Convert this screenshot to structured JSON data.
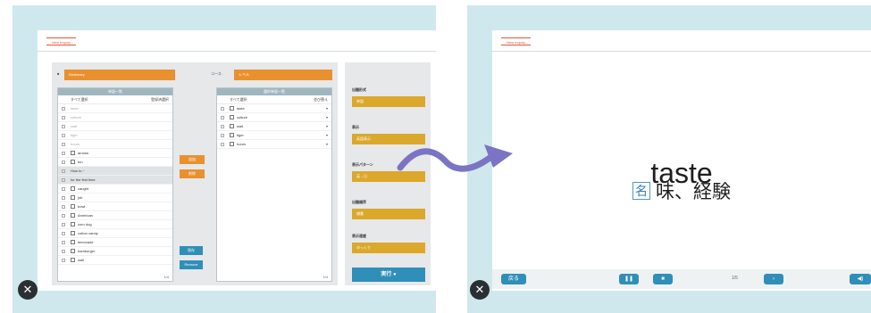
{
  "colors": {
    "frame": "#cfe8ee",
    "accent_orange": "#e8912e",
    "accent_yellow": "#dba82c",
    "blue": "#2f8fb8",
    "arrow": "#7b74c4"
  },
  "left": {
    "header_tab": "New Inquiry",
    "top_select_1": "Dictionary",
    "top_label_2": "コース:",
    "top_select_2": "レベル",
    "left_list": {
      "title": "単語一覧",
      "select_all": "すべて選択",
      "sub": "登録済選択",
      "rows": [
        {
          "text": "taste",
          "dim": true,
          "plus": false
        },
        {
          "text": "culture",
          "dim": true,
          "plus": false
        },
        {
          "text": "wait",
          "dim": true,
          "plus": false
        },
        {
          "text": "tiger",
          "dim": true,
          "plus": false
        },
        {
          "text": "hours",
          "dim": true,
          "plus": false
        },
        {
          "text": "arrows",
          "dim": false,
          "plus": true
        },
        {
          "text": "fun",
          "dim": false,
          "plus": true
        },
        {
          "text": "How to ~",
          "dim": false,
          "plus": false,
          "shaded": true
        },
        {
          "text": "for the first time",
          "dim": false,
          "plus": false,
          "shaded": true
        },
        {
          "text": "caught",
          "dim": false,
          "plus": true
        },
        {
          "text": "job",
          "dim": false,
          "plus": true
        },
        {
          "text": "bowl",
          "dim": false,
          "plus": true
        },
        {
          "text": "American",
          "dim": false,
          "plus": true
        },
        {
          "text": "corn dog",
          "dim": false,
          "plus": true
        },
        {
          "text": "cotton candy",
          "dim": false,
          "plus": true
        },
        {
          "text": "lemonade",
          "dim": false,
          "plus": true
        },
        {
          "text": "hamburger",
          "dim": false,
          "plus": true
        },
        {
          "text": "wall",
          "dim": false,
          "plus": true
        }
      ],
      "page": "1/4"
    },
    "right_list": {
      "title": "選択単語一覧",
      "select_all": "すべて選択",
      "sub": "並び替え",
      "rows": [
        {
          "text": "taste"
        },
        {
          "text": "culture"
        },
        {
          "text": "wait"
        },
        {
          "text": "tiger"
        },
        {
          "text": "hours"
        }
      ],
      "page": "1/4"
    },
    "add_button": "追加",
    "remove_button": "削除",
    "mid_blue_1": "保存",
    "mid_blue_2": "Remove",
    "settings": {
      "s1_label": "出題形式",
      "s1_value": "単語",
      "s2_label": "表示",
      "s2_value": "英語表示",
      "s3_label": "表示パターン",
      "s3_value": "英→日",
      "s4_label": "出題順序",
      "s4_value": "順番",
      "s5_label": "表示速度",
      "s5_value": "ゆっくり",
      "execute": "実行"
    }
  },
  "right": {
    "header_tab": "New Inquiry",
    "word": "taste",
    "pos": "名",
    "meaning": "味、経験",
    "back_button": "戻る",
    "counter": "1/5"
  },
  "icons": {
    "close": "close-icon",
    "play": "play-icon",
    "pause": "pause-icon",
    "arrow": "curved-arrow-icon"
  }
}
